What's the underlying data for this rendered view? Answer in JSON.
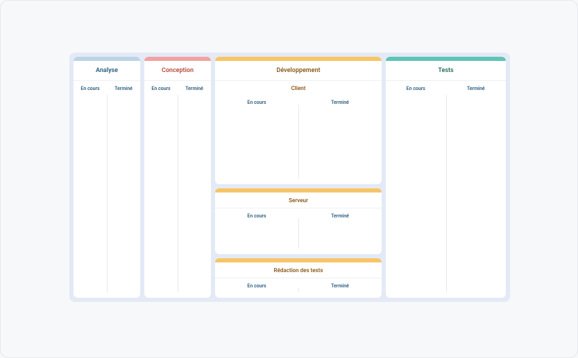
{
  "columns": {
    "analyse": {
      "title": "Analyse",
      "lanes": {
        "in_progress": "En cours",
        "done": "Terminé"
      }
    },
    "conception": {
      "title": "Conception",
      "lanes": {
        "in_progress": "En cours",
        "done": "Terminé"
      }
    },
    "development": {
      "title": "Développement",
      "sections": {
        "client": {
          "title": "Client",
          "lanes": {
            "in_progress": "En cours",
            "done": "Terminé"
          }
        },
        "serveur": {
          "title": "Serveur",
          "lanes": {
            "in_progress": "En cours",
            "done": "Terminé"
          }
        },
        "redaction_tests": {
          "title": "Rédaction des tests",
          "lanes": {
            "in_progress": "En cours",
            "done": "Terminé"
          }
        }
      }
    },
    "tests": {
      "title": "Tests",
      "lanes": {
        "in_progress": "En cours",
        "done": "Terminé"
      }
    }
  },
  "colors": {
    "analyse": "#bcd4e6",
    "conception": "#f2a2a2",
    "development": "#f6c566",
    "tests": "#5fc5b6"
  }
}
